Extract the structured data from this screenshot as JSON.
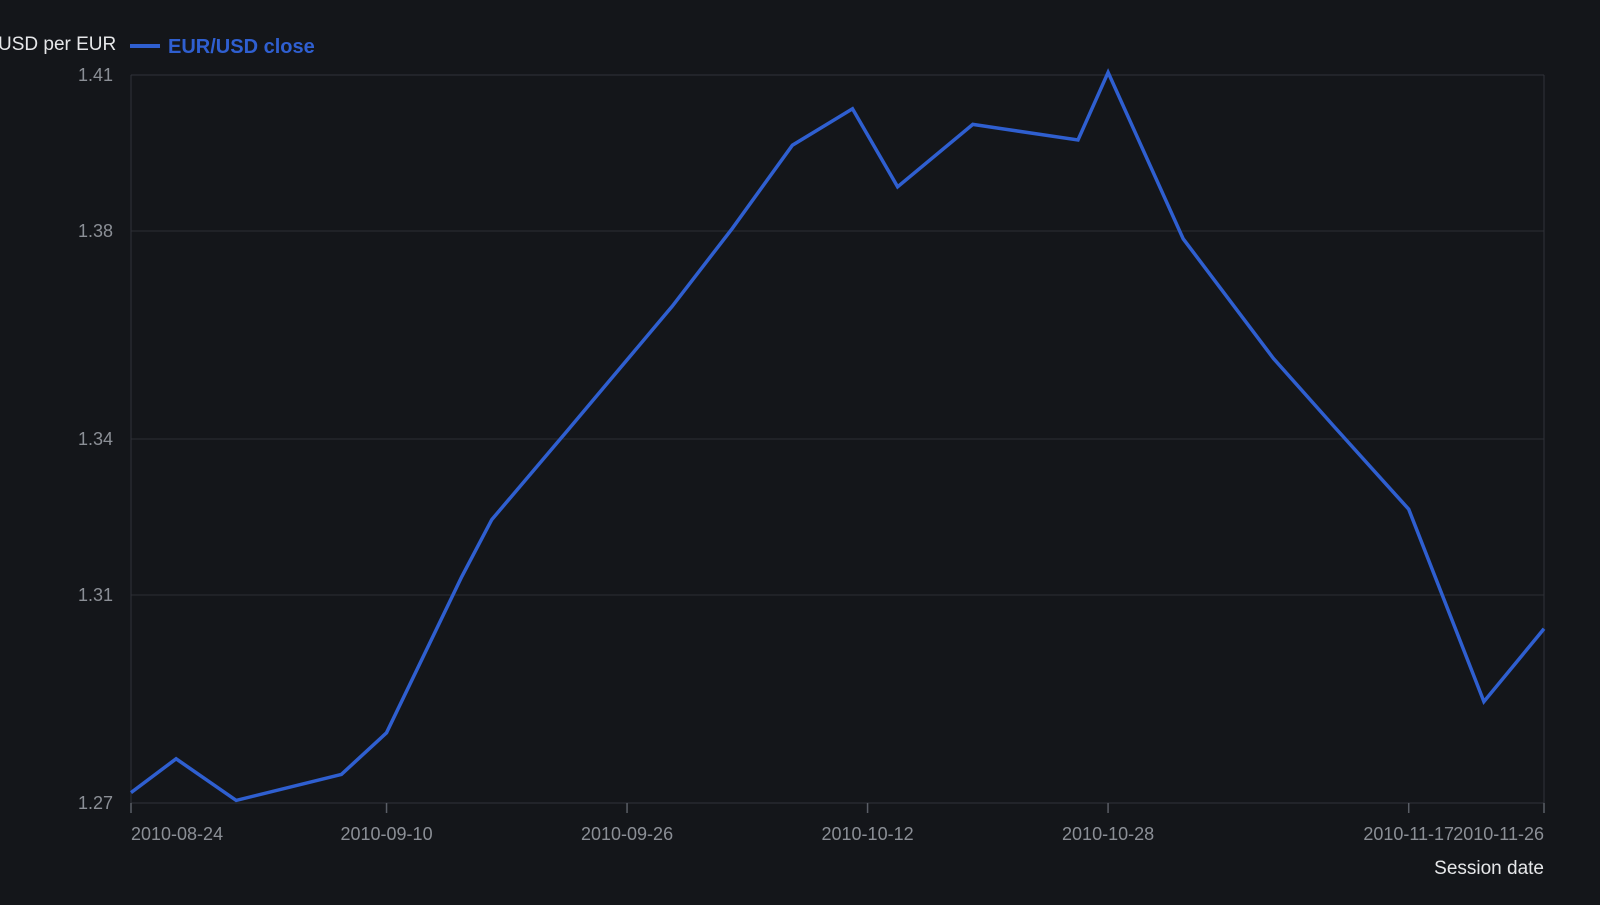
{
  "chart_data": {
    "type": "line",
    "title": "",
    "xlabel": "Session date",
    "ylabel": "USD per EUR",
    "xlim": [
      "2010-08-24",
      "2010-11-26"
    ],
    "ylim": [
      1.27,
      1.41
    ],
    "x_ticks": [
      "2010-08-24",
      "2010-09-10",
      "2010-09-26",
      "2010-10-12",
      "2010-10-28",
      "2010-11-17",
      "2010-11-26"
    ],
    "y_ticks": [
      {
        "value": 1.27,
        "label": "1.27"
      },
      {
        "value": 1.31,
        "label": "1.31"
      },
      {
        "value": 1.34,
        "label": "1.34"
      },
      {
        "value": 1.38,
        "label": "1.38"
      },
      {
        "value": 1.41,
        "label": "1.41"
      }
    ],
    "grid": true,
    "legend": "top-left",
    "series": [
      {
        "name": "EUR/USD close",
        "color": "#2f5fd0",
        "points": [
          {
            "x": "2010-08-24",
            "y": 1.272
          },
          {
            "x": "2010-08-27",
            "y": 1.2785
          },
          {
            "x": "2010-08-31",
            "y": 1.2705
          },
          {
            "x": "2010-09-07",
            "y": 1.2755
          },
          {
            "x": "2010-09-10",
            "y": 1.2835
          },
          {
            "x": "2010-09-15",
            "y": 1.3135
          },
          {
            "x": "2010-09-17",
            "y": 1.3245
          },
          {
            "x": "2010-09-22",
            "y": 1.3415
          },
          {
            "x": "2010-09-29",
            "y": 1.3655
          },
          {
            "x": "2010-10-03",
            "y": 1.3805
          },
          {
            "x": "2010-10-07",
            "y": 1.3965
          },
          {
            "x": "2010-10-11",
            "y": 1.4035
          },
          {
            "x": "2010-10-14",
            "y": 1.3885
          },
          {
            "x": "2010-10-19",
            "y": 1.4005
          },
          {
            "x": "2010-10-26",
            "y": 1.3975
          },
          {
            "x": "2010-10-28",
            "y": 1.4105
          },
          {
            "x": "2010-11-02",
            "y": 1.3785
          },
          {
            "x": "2010-11-08",
            "y": 1.3555
          },
          {
            "x": "2010-11-12",
            "y": 1.3425
          },
          {
            "x": "2010-11-17",
            "y": 1.3265
          },
          {
            "x": "2010-11-22",
            "y": 1.2895
          },
          {
            "x": "2010-11-26",
            "y": 1.3035
          }
        ]
      }
    ]
  }
}
